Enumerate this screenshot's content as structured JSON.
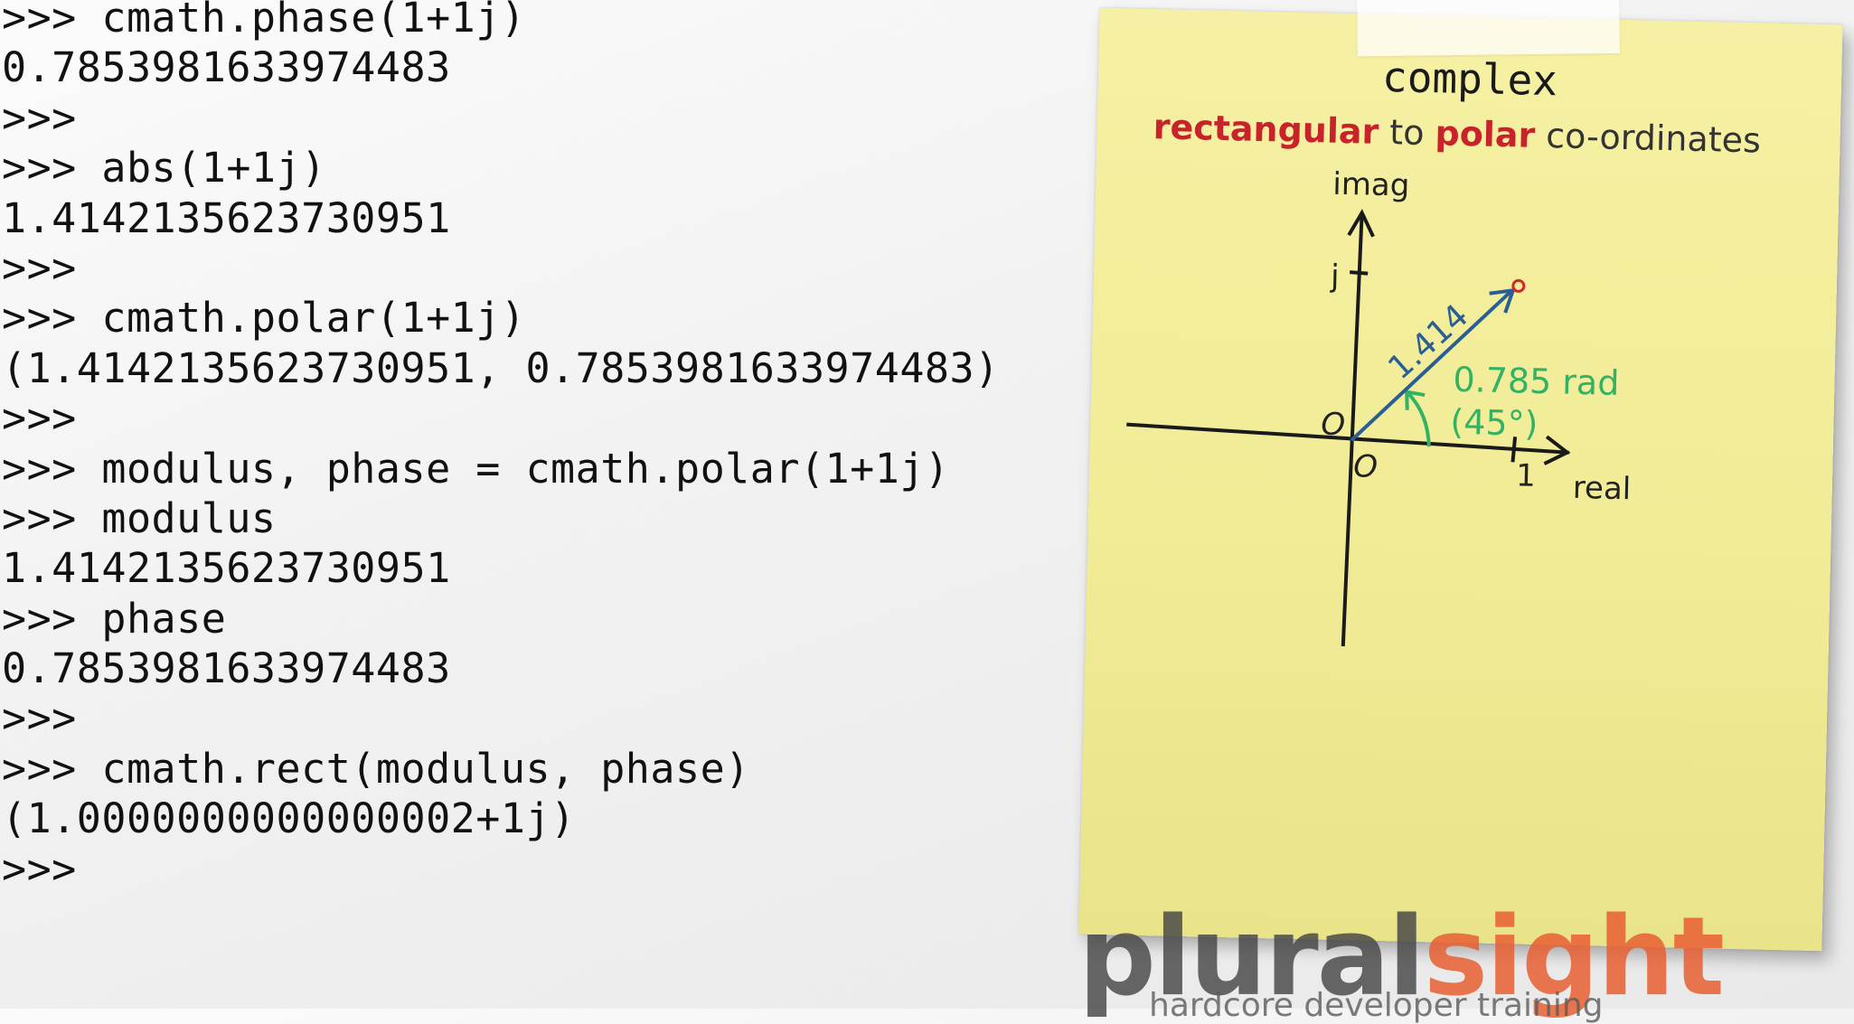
{
  "console": {
    "lines": [
      ">>> cmath.phase(1+1j)",
      "0.7853981633974483",
      ">>>",
      ">>> abs(1+1j)",
      "1.4142135623730951",
      ">>>",
      ">>> cmath.polar(1+1j)",
      "(1.4142135623730951, 0.7853981633974483)",
      ">>>",
      ">>> modulus, phase = cmath.polar(1+1j)",
      ">>> modulus",
      "1.4142135623730951",
      ">>> phase",
      "0.7853981633974483",
      ">>>",
      ">>> cmath.rect(modulus, phase)",
      "(1.0000000000000002+1j)",
      ">>>"
    ]
  },
  "note": {
    "title": "complex",
    "subtitle": {
      "word1": "rectangular",
      "word2": " to ",
      "word3": "polar",
      "word4": " co-ordinates"
    },
    "diagram": {
      "imag_label": "imag",
      "real_label": "real",
      "j_label": "j",
      "one_label": "1",
      "origin_label": "O",
      "origin_label_2": "O",
      "modulus_label": "1.414",
      "angle_rad_label": "0.785 rad",
      "angle_deg_label": "(45°)",
      "colors": {
        "vector": "#2a5f95",
        "angle": "#33b264",
        "point": "#d0282c",
        "axes": "#1a1a1a"
      }
    }
  },
  "logo": {
    "word_part1": "plural",
    "word_part2": "sight",
    "tagline": "hardcore developer training"
  }
}
